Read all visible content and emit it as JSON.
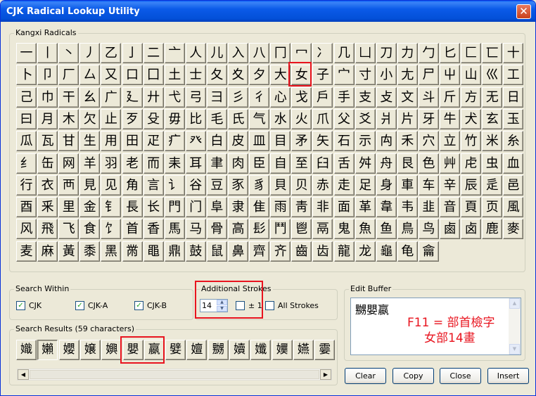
{
  "window": {
    "title": "CJK Radical Lookup Utility",
    "close_glyph": "✕"
  },
  "radicals": {
    "label": "Kangxi Radicals",
    "rows": [
      [
        "一",
        "丨",
        "丶",
        "丿",
        "乙",
        "亅",
        "二",
        "亠",
        "人",
        "儿",
        "入",
        "八",
        "冂",
        "冖",
        "冫",
        "几",
        "凵",
        "刀",
        "力",
        "勹",
        "匕",
        "匚",
        "匸",
        "十"
      ],
      [
        "卜",
        "卩",
        "厂",
        "厶",
        "又",
        "口",
        "囗",
        "土",
        "士",
        "夂",
        "夊",
        "夕",
        "大",
        "女",
        "子",
        "宀",
        "寸",
        "小",
        "尢",
        "尸",
        "屮",
        "山",
        "巛",
        "工"
      ],
      [
        "己",
        "巾",
        "干",
        "幺",
        "广",
        "廴",
        "廾",
        "弋",
        "弓",
        "彐",
        "彡",
        "彳",
        "心",
        "戈",
        "戶",
        "手",
        "支",
        "攴",
        "文",
        "斗",
        "斤",
        "方",
        "无",
        "日"
      ],
      [
        "曰",
        "月",
        "木",
        "欠",
        "止",
        "歹",
        "殳",
        "毋",
        "比",
        "毛",
        "氏",
        "气",
        "水",
        "火",
        "爪",
        "父",
        "爻",
        "爿",
        "片",
        "牙",
        "牛",
        "犬",
        "玄",
        "玉"
      ],
      [
        "瓜",
        "瓦",
        "甘",
        "生",
        "用",
        "田",
        "疋",
        "疒",
        "癶",
        "白",
        "皮",
        "皿",
        "目",
        "矛",
        "矢",
        "石",
        "示",
        "禸",
        "禾",
        "穴",
        "立",
        "竹",
        "米",
        "糸"
      ],
      [
        "纟",
        "缶",
        "网",
        "羊",
        "羽",
        "老",
        "而",
        "耒",
        "耳",
        "聿",
        "肉",
        "臣",
        "自",
        "至",
        "臼",
        "舌",
        "舛",
        "舟",
        "艮",
        "色",
        "艸",
        "虍",
        "虫",
        "血"
      ],
      [
        "行",
        "衣",
        "襾",
        "見",
        "见",
        "角",
        "言",
        "讠",
        "谷",
        "豆",
        "豕",
        "豸",
        "貝",
        "贝",
        "赤",
        "走",
        "足",
        "身",
        "車",
        "车",
        "辛",
        "辰",
        "辵",
        "邑"
      ],
      [
        "酉",
        "釆",
        "里",
        "金",
        "钅",
        "長",
        "长",
        "門",
        "门",
        "阜",
        "隶",
        "隹",
        "雨",
        "靑",
        "非",
        "面",
        "革",
        "韋",
        "韦",
        "韭",
        "音",
        "頁",
        "页",
        "風"
      ],
      [
        "风",
        "飛",
        "飞",
        "食",
        "饣",
        "首",
        "香",
        "馬",
        "马",
        "骨",
        "高",
        "髟",
        "鬥",
        "鬯",
        "鬲",
        "鬼",
        "魚",
        "鱼",
        "鳥",
        "鸟",
        "鹵",
        "卤",
        "鹿",
        "麥"
      ],
      [
        "麦",
        "麻",
        "黃",
        "黍",
        "黑",
        "黹",
        "黽",
        "鼎",
        "鼓",
        "鼠",
        "鼻",
        "齊",
        "齐",
        "齒",
        "齿",
        "龍",
        "龙",
        "龜",
        "龟",
        "龠"
      ]
    ]
  },
  "search_within": {
    "label": "Search Within",
    "options": [
      {
        "label": "CJK",
        "checked": true,
        "mark": "✓"
      },
      {
        "label": "CJK-A",
        "checked": true,
        "mark": "✓"
      },
      {
        "label": "CJK-B",
        "checked": true,
        "mark": "✓"
      }
    ]
  },
  "additional_strokes": {
    "label": "Additional Strokes",
    "value": "14",
    "up_glyph": "▲",
    "down_glyph": "▼",
    "pm1_label": "± 1",
    "pm1_checked": false,
    "all_strokes_label": "All Strokes",
    "all_strokes_checked": false
  },
  "search_results": {
    "label": "Search Results (59 characters)",
    "chars": [
      "嬂",
      "嬾",
      "孆",
      "嬢",
      "嬹",
      "嬰",
      "嬴",
      "嬖",
      "嬗",
      "嬲",
      "嬻",
      "孅",
      "嬽",
      "嬿",
      "孁"
    ]
  },
  "scroll": {
    "left_arrow": "◀",
    "right_arrow": "▶",
    "up_arrow": "▲",
    "down_arrow": "▼"
  },
  "edit_buffer": {
    "label": "Edit Buffer",
    "text": "嬲嬰嬴",
    "note_line1": "F11 = 部首檢字",
    "note_line2": "女部14畫"
  },
  "buttons": {
    "clear": "Clear",
    "copy": "Copy",
    "close": "Close",
    "insert": "Insert"
  },
  "accent_colors": {
    "highlight": "#e8141f",
    "title_bar": "#0350d8"
  }
}
